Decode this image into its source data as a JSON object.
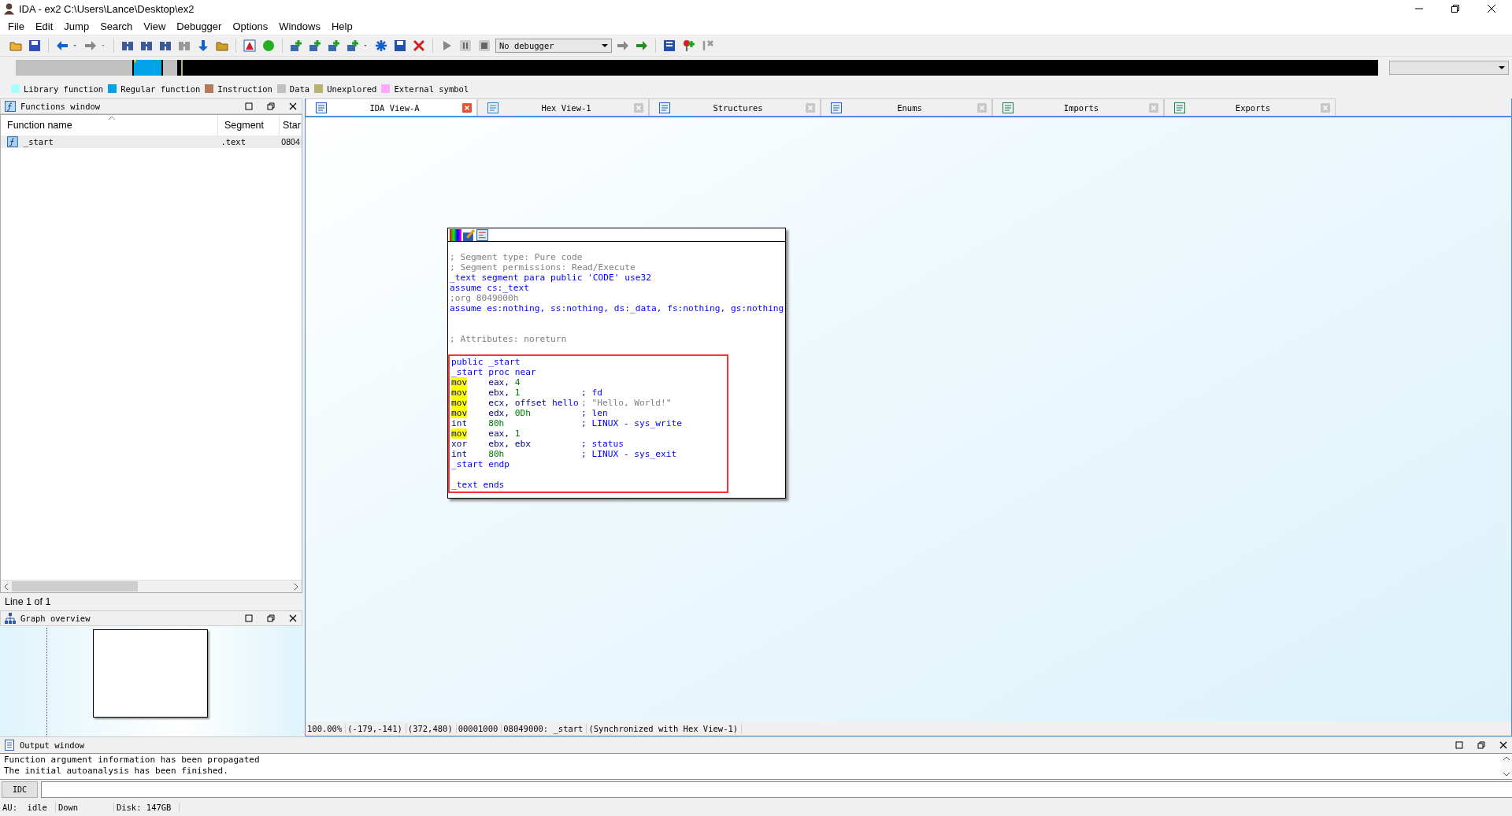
{
  "window": {
    "title": "IDA - ex2 C:\\Users\\Lance\\Desktop\\ex2"
  },
  "menu": [
    "File",
    "Edit",
    "Jump",
    "Search",
    "View",
    "Debugger",
    "Options",
    "Windows",
    "Help"
  ],
  "toolbar": {
    "debugger_select": "No debugger"
  },
  "legend": [
    {
      "label": "Library function",
      "color": "#a8ffff"
    },
    {
      "label": "Regular function",
      "color": "#00a2e8"
    },
    {
      "label": "Instruction",
      "color": "#b47a5a"
    },
    {
      "label": "Data",
      "color": "#c0c0c0"
    },
    {
      "label": "Unexplored",
      "color": "#b4b46e"
    },
    {
      "label": "External symbol",
      "color": "#ffa8ff"
    }
  ],
  "functions_window": {
    "title": "Functions window",
    "columns": [
      "Function name",
      "Segment",
      "Star"
    ],
    "rows": [
      {
        "cells": [
          "_start",
          ".text",
          "0804"
        ],
        "selected": true
      }
    ],
    "status": "Line 1 of 1"
  },
  "graph_overview": {
    "title": "Graph overview"
  },
  "tabs": [
    {
      "label": "IDA View-A",
      "selected": true
    },
    {
      "label": "Hex View-1",
      "selected": false
    },
    {
      "label": "Structures",
      "selected": false
    },
    {
      "label": "Enums",
      "selected": false
    },
    {
      "label": "Imports",
      "selected": false
    },
    {
      "label": "Exports",
      "selected": false
    }
  ],
  "graph_node": {
    "sections": [
      {
        "selected": false,
        "lines": [
          {
            "kind": "blank"
          },
          {
            "kind": "comment",
            "text": "; Segment type: Pure code"
          },
          {
            "kind": "comment",
            "text": "; Segment permissions: Read/Execute"
          },
          {
            "kind": "directive",
            "text": "_text segment para public 'CODE' use32"
          },
          {
            "kind": "directive",
            "text": "assume cs:_text"
          },
          {
            "kind": "comment",
            "text": ";org 8049000h"
          },
          {
            "kind": "directive",
            "text": "assume es:nothing, ss:nothing, ds:_data, fs:nothing, gs:nothing"
          },
          {
            "kind": "blank"
          },
          {
            "kind": "blank"
          },
          {
            "kind": "comment",
            "text": "; Attributes: noreturn"
          },
          {
            "kind": "blank"
          }
        ]
      },
      {
        "selected": true,
        "lines": [
          {
            "kind": "directive",
            "text": "public _start"
          },
          {
            "kind": "directive",
            "text": "_start proc near"
          },
          {
            "kind": "insn",
            "mnemonic": "mov",
            "highlighted": true,
            "operands": [
              {
                "text": "eax,",
                "kind": "reg"
              },
              {
                "text": "4",
                "kind": "number"
              }
            ]
          },
          {
            "kind": "insn",
            "mnemonic": "mov",
            "highlighted": true,
            "operands": [
              {
                "text": "ebx,",
                "kind": "reg"
              },
              {
                "text": "1",
                "kind": "number"
              }
            ],
            "comment": {
              "text": "; fd",
              "kind": "name"
            }
          },
          {
            "kind": "insn",
            "mnemonic": "mov",
            "highlighted": true,
            "operands": [
              {
                "text": "ecx,",
                "kind": "reg"
              },
              {
                "text": "offset",
                "kind": "reg"
              },
              {
                "text": "hello",
                "kind": "name"
              }
            ],
            "comment": {
              "text": "; \"Hello, World!\"",
              "kind": "string"
            }
          },
          {
            "kind": "insn",
            "mnemonic": "mov",
            "highlighted": true,
            "operands": [
              {
                "text": "edx,",
                "kind": "reg"
              },
              {
                "text": "0Dh",
                "kind": "number"
              }
            ],
            "comment": {
              "text": "; len",
              "kind": "name"
            }
          },
          {
            "kind": "insn",
            "mnemonic": "int",
            "highlighted": false,
            "operands": [
              {
                "text": "80h",
                "kind": "number"
              }
            ],
            "comment": {
              "text": "; LINUX - sys_write",
              "kind": "name"
            }
          },
          {
            "kind": "insn",
            "mnemonic": "mov",
            "highlighted": true,
            "operands": [
              {
                "text": "eax,",
                "kind": "reg"
              },
              {
                "text": "1",
                "kind": "number"
              }
            ]
          },
          {
            "kind": "insn",
            "mnemonic": "xor",
            "highlighted": false,
            "operands": [
              {
                "text": "ebx,",
                "kind": "reg"
              },
              {
                "text": "ebx",
                "kind": "reg"
              }
            ],
            "comment": {
              "text": "; status",
              "kind": "name"
            }
          },
          {
            "kind": "insn",
            "mnemonic": "int",
            "highlighted": false,
            "operands": [
              {
                "text": "80h",
                "kind": "number"
              }
            ],
            "comment": {
              "text": "; LINUX - sys_exit",
              "kind": "name"
            }
          },
          {
            "kind": "directive",
            "text": "_start endp"
          },
          {
            "kind": "blank"
          },
          {
            "kind": "directive",
            "text": "_text ends"
          }
        ]
      }
    ]
  },
  "view_status": [
    "100.00%",
    "(-179,-141)",
    "(372,480)",
    "00001000",
    "08049000: _start",
    "(Synchronized with Hex View-1)"
  ],
  "output_window": {
    "title": "Output window",
    "lines": [
      "Function argument information has been propagated",
      "The initial autoanalysis has been finished."
    ],
    "command_button": "IDC"
  },
  "status_bar": [
    "AU:  idle",
    "Down",
    "Disk: 147GB"
  ]
}
